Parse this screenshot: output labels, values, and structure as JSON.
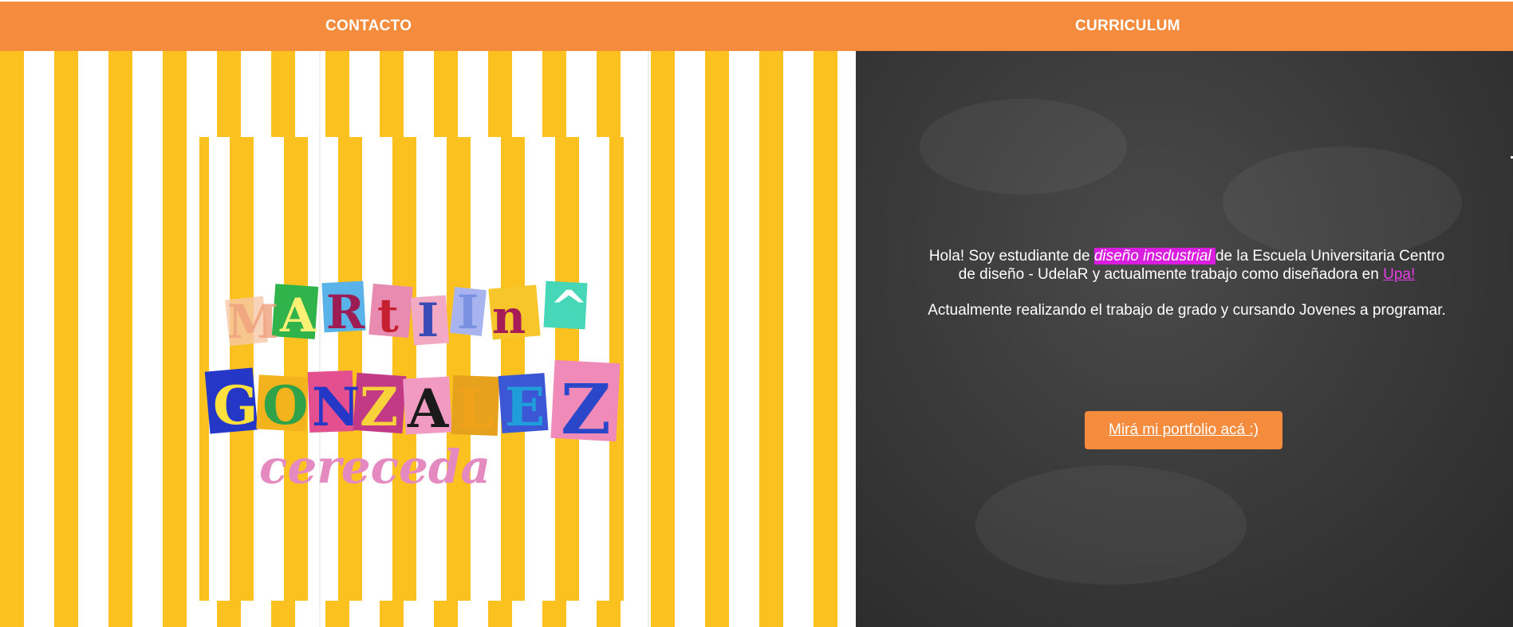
{
  "nav": {
    "contacto": "CONTACTO",
    "curriculum": "CURRICULUM"
  },
  "colors": {
    "accent": "#f48b3d",
    "stripe_yellow": "#fbc21f",
    "highlight": "#d91ee0",
    "link": "#e63de8",
    "chalkboard": "#3b3b3b"
  },
  "logo": {
    "line1": "MARTINA",
    "line2": "GONZALEZ",
    "line3": "cereceda"
  },
  "bio": {
    "p1_start": "Hola! Soy estudiante de ",
    "p1_highlight": "diseño insdustrial ",
    "p1_middle": "de la Escuela Universitaria Centro de diseño - UdelaR y actualmente trabajo como diseñadora en ",
    "p1_link": "Upa!",
    "p2": "Actualmente realizando el trabajo de grado y cursando Jovenes a programar."
  },
  "cta": {
    "portfolio": "Mirá mi portfolio acá :)"
  }
}
